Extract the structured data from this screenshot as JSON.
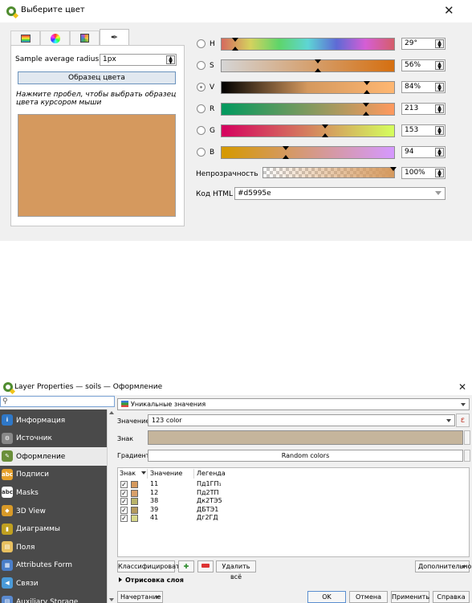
{
  "color_dialog": {
    "title": "Выберите цвет",
    "tabs": [
      "ramp-icon",
      "wheel-icon",
      "swatch-grid-icon",
      "eyedropper-icon"
    ],
    "active_tab": 3,
    "sample_radius_label": "Sample average radius",
    "sample_radius_value": "1px",
    "sample_button": "Образец цвета",
    "sample_hint": "Нажмите пробел, чтобы выбрать образец цвета курсором мыши",
    "current_color": "#d5995e",
    "channels": [
      {
        "label": "H",
        "value": "29°",
        "fraction": 0.08,
        "gradient": "linear-gradient(90deg,#d56a5e,#d5d25e,#5ed56a,#5ed5d5,#5e6ad5,#d55ed5,#d55e6a)"
      },
      {
        "label": "S",
        "value": "56%",
        "fraction": 0.56,
        "gradient": "linear-gradient(90deg,#d5d5d5,#d56f10)"
      },
      {
        "label": "V",
        "value": "84%",
        "fraction": 0.84,
        "selected": true,
        "gradient": "linear-gradient(90deg,#000000,#d5995e,#ffb772)"
      },
      {
        "label": "R",
        "value": "213",
        "fraction": 0.835,
        "gradient": "linear-gradient(90deg,#00995e,#ff995e)"
      },
      {
        "label": "G",
        "value": "153",
        "fraction": 0.6,
        "gradient": "linear-gradient(90deg,#d5005e,#d5ff5e)"
      },
      {
        "label": "B",
        "value": "94",
        "fraction": 0.37,
        "gradient": "linear-gradient(90deg,#d59900,#d599ff)"
      }
    ],
    "opacity_label": "Непрозрачность",
    "opacity_value": "100%",
    "html_label": "Код HTML",
    "html_value": "#d5995e"
  },
  "layer_props": {
    "title": "Layer Properties — soils — Оформление",
    "sidebar": [
      {
        "label": "Информация",
        "icon": "info-icon",
        "color": "#2f78c8",
        "glyph": "i"
      },
      {
        "label": "Источник",
        "icon": "source-icon",
        "color": "#888888",
        "glyph": "⚙"
      },
      {
        "label": "Оформление",
        "icon": "symbology-icon",
        "color": "#6a8f3a",
        "glyph": "✎",
        "active": true
      },
      {
        "label": "Подписи",
        "icon": "labels-icon",
        "color": "#e6a02a",
        "glyph": "abc"
      },
      {
        "label": "Masks",
        "icon": "masks-icon",
        "color": "#ffffff",
        "glyph": "abc"
      },
      {
        "label": "3D View",
        "icon": "3d-view-icon",
        "color": "#d89a28",
        "glyph": "◆"
      },
      {
        "label": "Диаграммы",
        "icon": "diagrams-icon",
        "color": "#c0a020",
        "glyph": "▮"
      },
      {
        "label": "Поля",
        "icon": "fields-icon",
        "color": "#e8c060",
        "glyph": "▤"
      },
      {
        "label": "Attributes Form",
        "icon": "attributes-form-icon",
        "color": "#4a7ec8",
        "glyph": "▦"
      },
      {
        "label": "Связи",
        "icon": "joins-icon",
        "color": "#4a9ad8",
        "glyph": "◀"
      },
      {
        "label": "Auxiliary Storage",
        "icon": "aux-storage-icon",
        "color": "#5a8ad0",
        "glyph": "▤"
      }
    ],
    "renderer": "Уникальные значения",
    "value_label": "Значение",
    "value_field": "123 color",
    "symbol_label": "Знак",
    "symbol_color": "#c5b59c",
    "gradient_label": "Градиент",
    "gradient_value": "Random colors",
    "columns": [
      "Знак",
      "Значение",
      "Легенда"
    ],
    "rows": [
      {
        "value": "11",
        "legend": "Пд1ГП₁",
        "color": "#d5995e"
      },
      {
        "value": "12",
        "legend": "Пд2ТП",
        "color": "#d9a06a"
      },
      {
        "value": "38",
        "legend": "Дк2ТЭ5",
        "color": "#b9b46a"
      },
      {
        "value": "39",
        "legend": "ДБТЭ1",
        "color": "#b59a5e"
      },
      {
        "value": "41",
        "legend": "Дг2ГД",
        "color": "#d8d88a"
      }
    ],
    "buttons": {
      "classify": "Классифицировать",
      "delete_all": "Удалить всё",
      "advanced": "Дополнительно",
      "render_section": "Отрисовка слоя",
      "style": "Начертание",
      "ok": "OK",
      "cancel": "Отмена",
      "apply": "Применить",
      "help": "Справка"
    }
  }
}
